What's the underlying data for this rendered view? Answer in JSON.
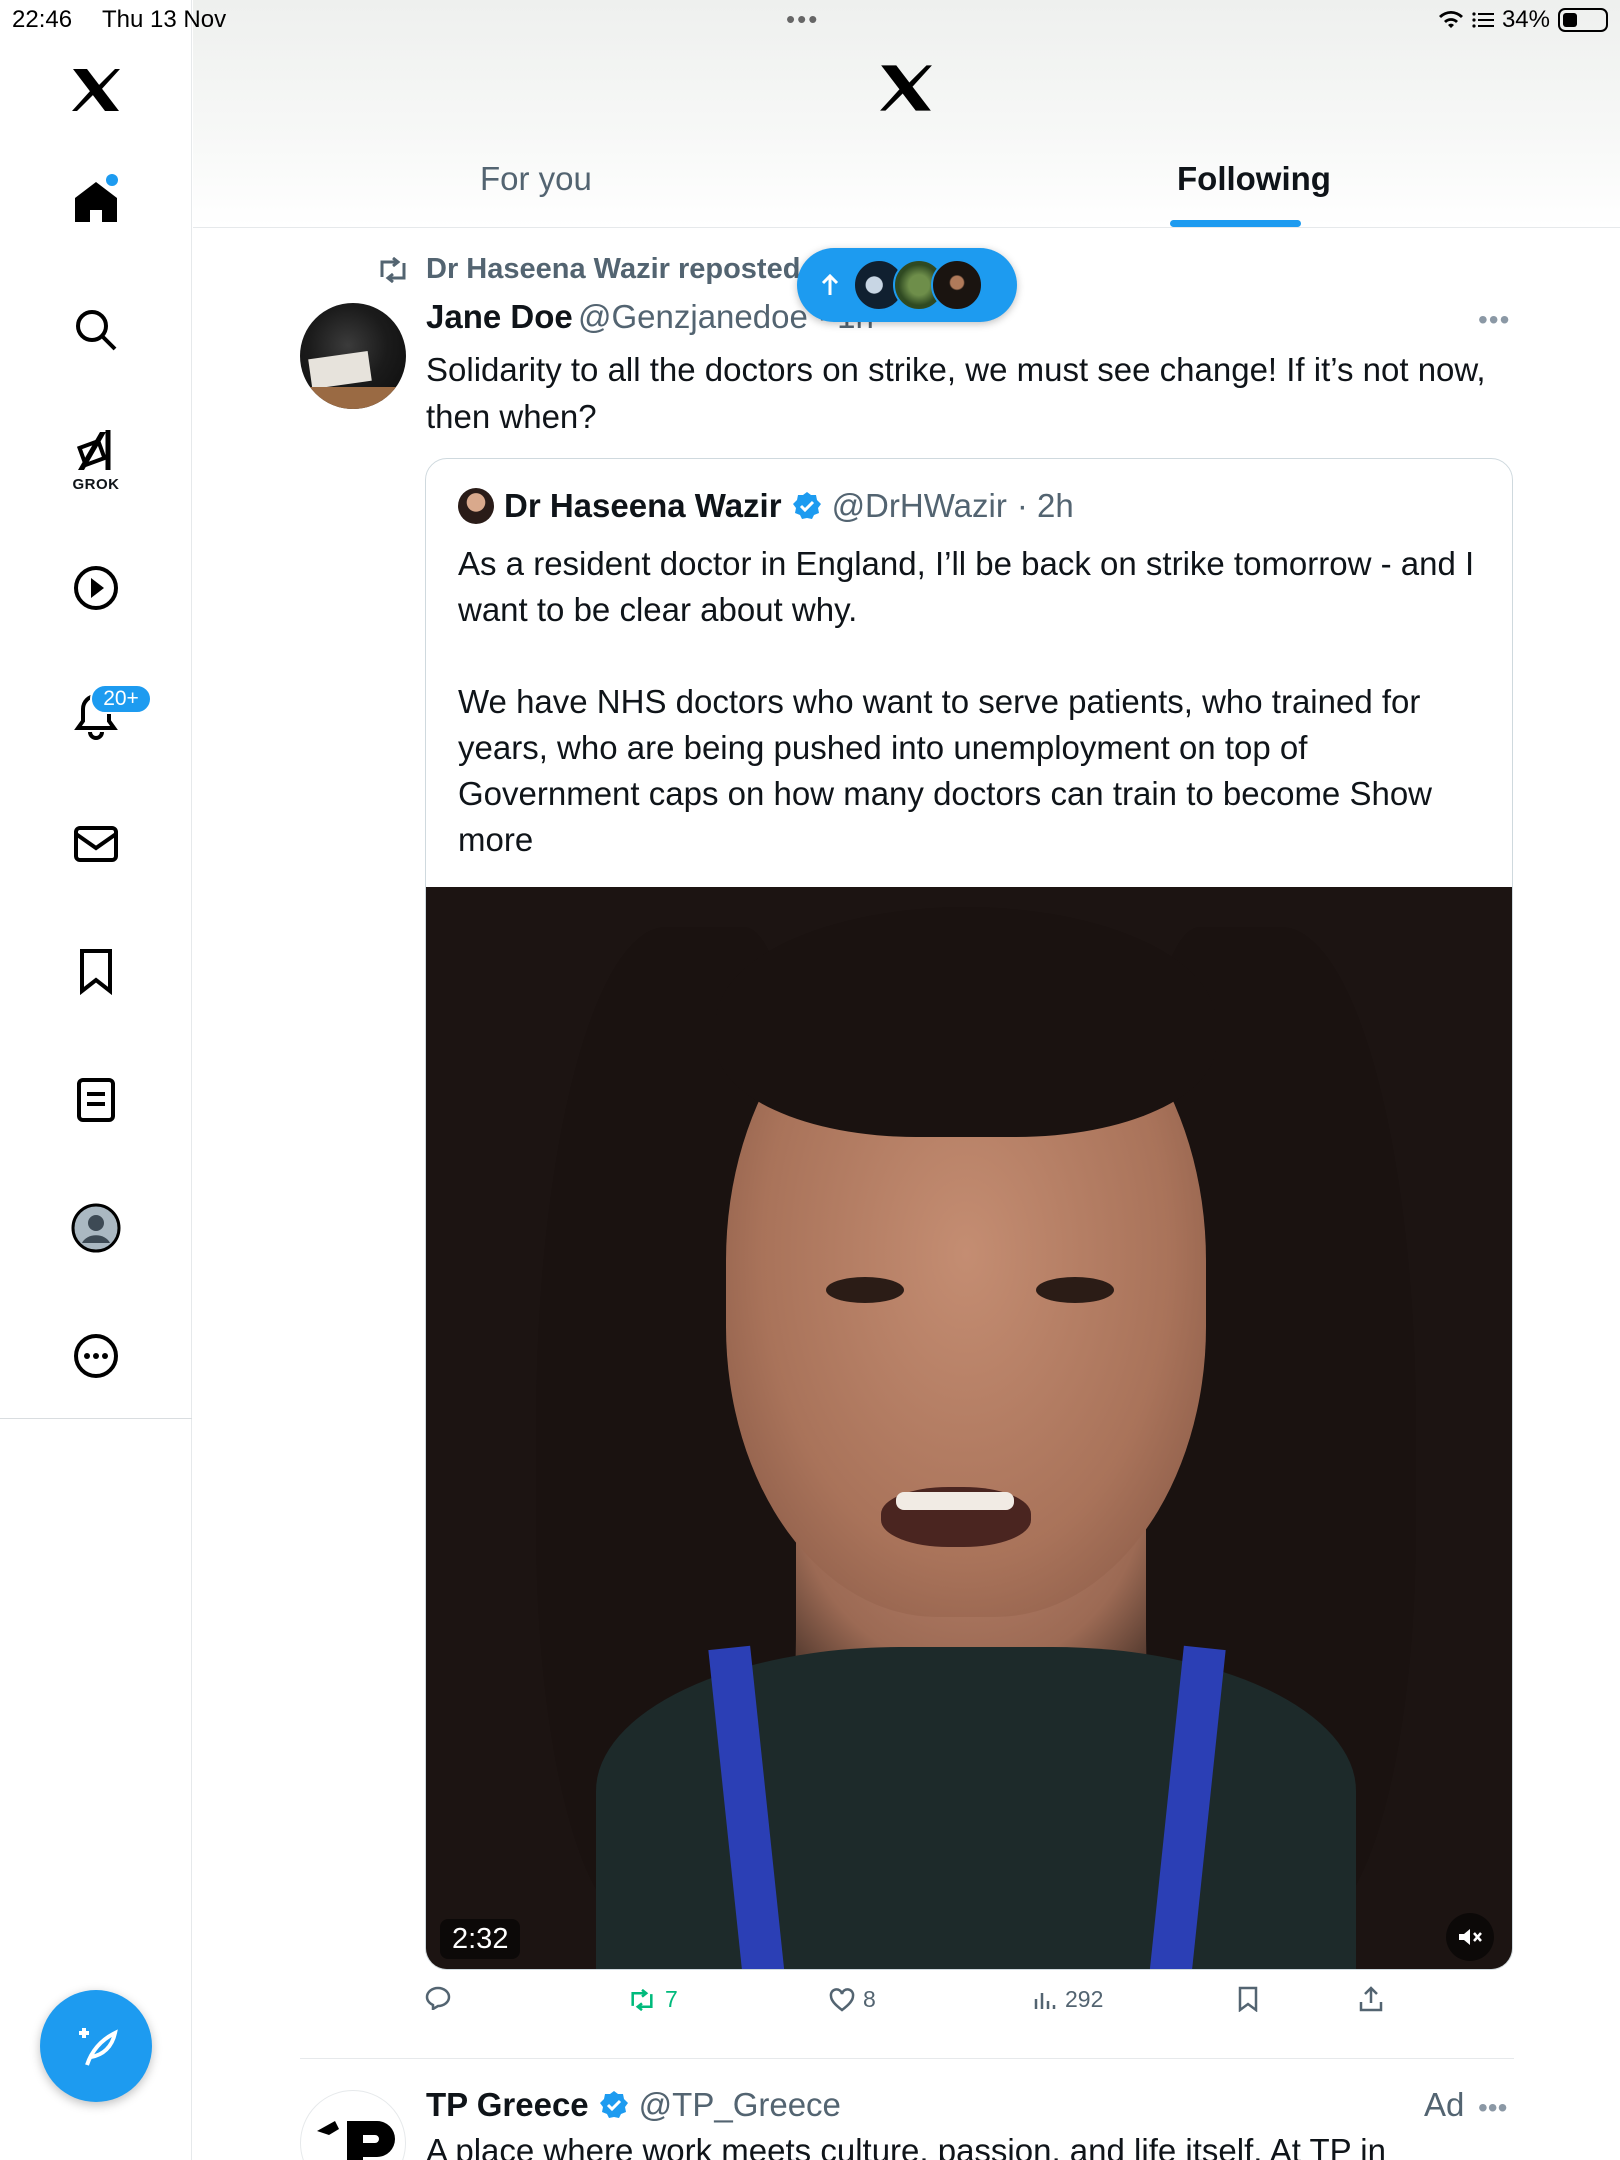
{
  "status_bar": {
    "time": "22:46",
    "date": "Thu 13 Nov",
    "battery": "34%",
    "battery_fraction": 0.34
  },
  "tabs": [
    {
      "label": "For you",
      "selected": false
    },
    {
      "label": "Following",
      "selected": true
    }
  ],
  "sidebar": {
    "grok_label": "GROK",
    "notifications_badge": "20+",
    "items": [
      "home-icon",
      "search-icon",
      "grok-icon",
      "video-icon",
      "notifications-icon",
      "messages-icon",
      "bookmarks-icon",
      "lists-icon",
      "profile-icon",
      "more-icon"
    ],
    "compose_icon": "compose-icon"
  },
  "feed": {
    "repost_label": "Dr Haseena Wazir reposted",
    "post": {
      "name": "Jane Doe",
      "handle_time": "@Genzjanedoe · 1h",
      "text": "Solidarity to all the doctors on strike, we must see change! If it’s not now, then when?"
    },
    "quote": {
      "name": "Dr Haseena Wazir",
      "handle": "@DrHWazir",
      "time": "· 2h",
      "text": "As a resident doctor in England, I’ll be back on strike tomorrow - and I want to be clear about why.\n\nWe have NHS doctors who want to serve patients, who trained for years, who are being pushed into unemployment on top of Government caps on how many doctors can train to become ",
      "show_more": "Show more",
      "video_duration": "2:32"
    },
    "actions": {
      "replies": "",
      "reposts": "7",
      "likes": "8",
      "views": "292"
    },
    "ad": {
      "name": "TP Greece",
      "handle": "@TP_Greece",
      "ad_label": "Ad",
      "text": "A place where work meets culture, passion, and life itself. At TP in"
    }
  },
  "colors": {
    "accent": "#1d9bf0",
    "retweet": "#00ba7c",
    "secondary_text": "#536471"
  }
}
